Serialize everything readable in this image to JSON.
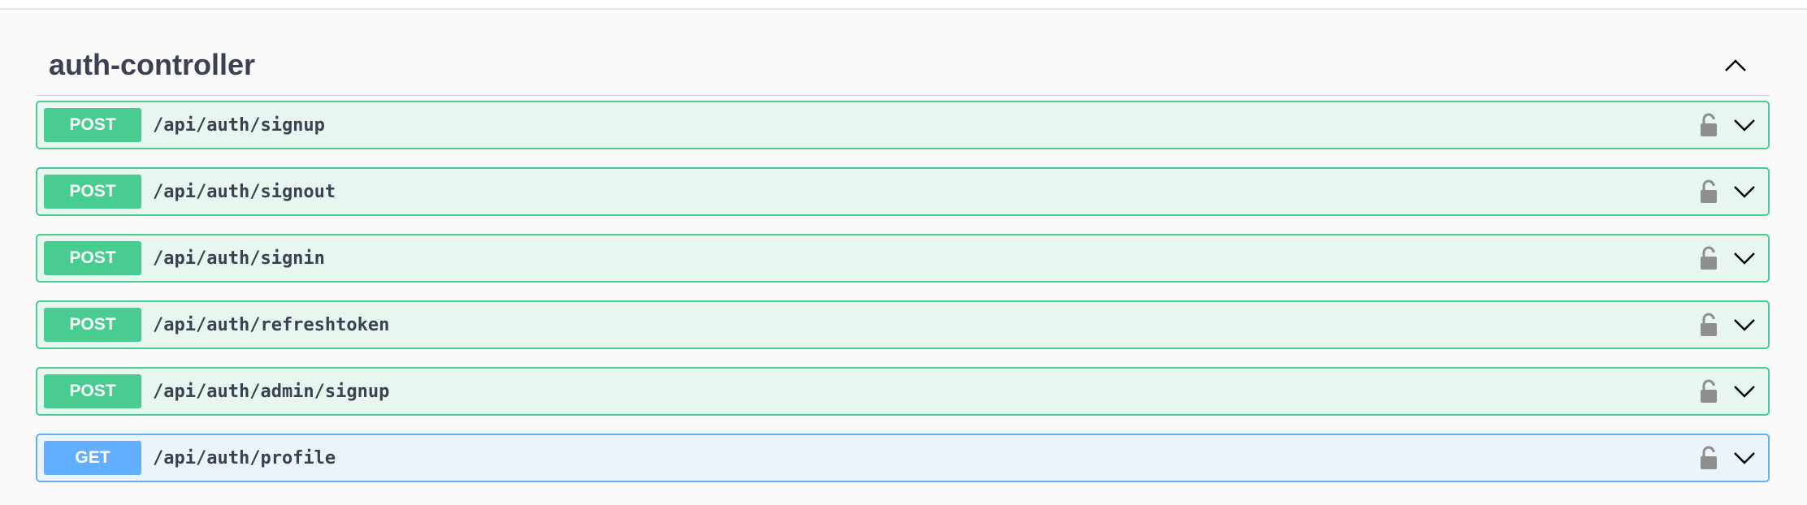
{
  "section": {
    "title": "auth-controller",
    "collapse_icon": "chevron-up-icon"
  },
  "colors": {
    "post": "#49cc90",
    "post_bg": "#e8f6f0",
    "get": "#61affe",
    "get_bg": "#ebf3fb",
    "text": "#3b4151"
  },
  "operations": [
    {
      "method": "POST",
      "path": "/api/auth/signup",
      "lock_icon": "unlocked-padlock-icon",
      "expand_icon": "chevron-down-icon"
    },
    {
      "method": "POST",
      "path": "/api/auth/signout",
      "lock_icon": "unlocked-padlock-icon",
      "expand_icon": "chevron-down-icon"
    },
    {
      "method": "POST",
      "path": "/api/auth/signin",
      "lock_icon": "unlocked-padlock-icon",
      "expand_icon": "chevron-down-icon"
    },
    {
      "method": "POST",
      "path": "/api/auth/refreshtoken",
      "lock_icon": "unlocked-padlock-icon",
      "expand_icon": "chevron-down-icon"
    },
    {
      "method": "POST",
      "path": "/api/auth/admin/signup",
      "lock_icon": "unlocked-padlock-icon",
      "expand_icon": "chevron-down-icon"
    },
    {
      "method": "GET",
      "path": "/api/auth/profile",
      "lock_icon": "unlocked-padlock-icon",
      "expand_icon": "chevron-down-icon"
    }
  ]
}
